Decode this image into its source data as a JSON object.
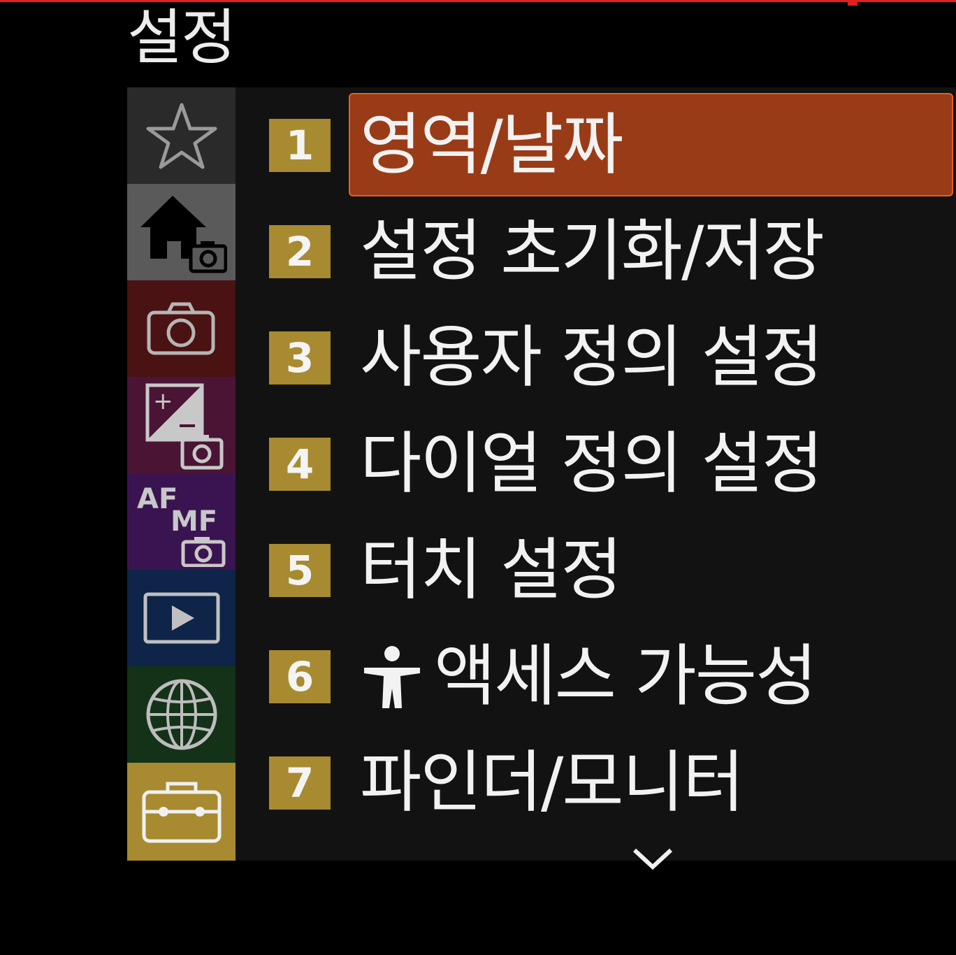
{
  "page_title": "설정",
  "colors": {
    "accent_selected": "#9a3b17",
    "selected_border": "#e0621c",
    "badge": "#a88a30",
    "panel": "#121212"
  },
  "sidebar": {
    "tabs": [
      {
        "icon": "star-icon",
        "name": "my-menu",
        "bg": "#2a2a2a"
      },
      {
        "icon": "home-camera-icon",
        "name": "main",
        "bg": "#5a5a5a"
      },
      {
        "icon": "camera-icon",
        "name": "shooting",
        "bg": "#4a1212"
      },
      {
        "icon": "exposure-camera-icon",
        "name": "exposure-color",
        "bg": "#4a1434"
      },
      {
        "icon": "af-mf-camera-icon",
        "name": "focus",
        "bg": "#3a1450",
        "text_af": "AF",
        "text_mf": "MF"
      },
      {
        "icon": "play-icon",
        "name": "playback",
        "bg": "#0e2448"
      },
      {
        "icon": "globe-icon",
        "name": "network",
        "bg": "#143218"
      },
      {
        "icon": "toolbox-icon",
        "name": "setup",
        "bg": "#a88a30"
      }
    ]
  },
  "menu": {
    "items": [
      {
        "number": "1",
        "label": "영역/날짜",
        "selected": true
      },
      {
        "number": "2",
        "label": "설정 초기화/저장",
        "selected": false
      },
      {
        "number": "3",
        "label": "사용자 정의 설정",
        "selected": false
      },
      {
        "number": "4",
        "label": "다이얼 정의 설정",
        "selected": false
      },
      {
        "number": "5",
        "label": "터치 설정",
        "selected": false
      },
      {
        "number": "6",
        "label": "액세스 가능성",
        "icon": "accessibility-icon",
        "selected": false
      },
      {
        "number": "7",
        "label": "파인더/모니터",
        "selected": false
      }
    ],
    "more_indicator": "chevron-down-icon"
  }
}
